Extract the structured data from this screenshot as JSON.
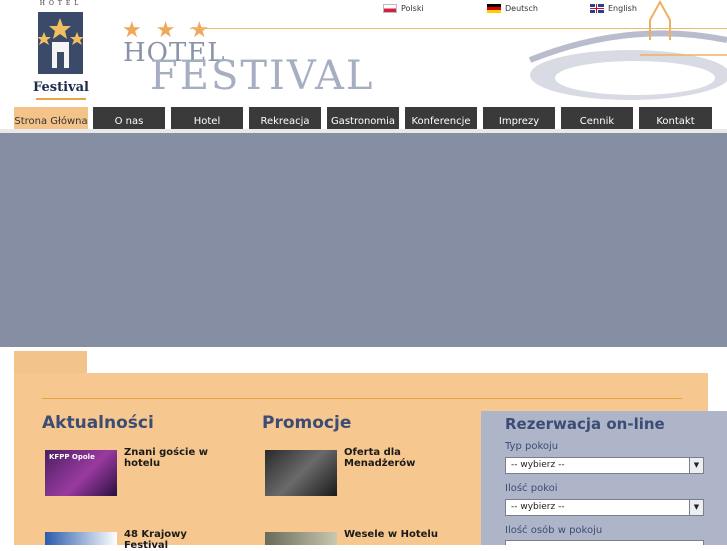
{
  "header": {
    "logo_small": "HOTEL",
    "logo_name": "Festival",
    "stars": "★★★",
    "title_hotel": "HOTEL",
    "title_festival": "FESTIVAL"
  },
  "languages": [
    {
      "label": "Polski",
      "flag": "poland-flag-icon"
    },
    {
      "label": "Deutsch",
      "flag": "germany-flag-icon"
    },
    {
      "label": "English",
      "flag": "uk-flag-icon"
    }
  ],
  "nav": [
    {
      "label": "Strona Główna",
      "active": true
    },
    {
      "label": "O nas"
    },
    {
      "label": "Hotel"
    },
    {
      "label": "Rekreacja"
    },
    {
      "label": "Gastronomia"
    },
    {
      "label": "Konferencje"
    },
    {
      "label": "Imprezy"
    },
    {
      "label": "Cennik"
    },
    {
      "label": "Kontakt"
    }
  ],
  "news": {
    "title": "Aktualności",
    "items": [
      {
        "text": "Znani goście w hotelu",
        "thumb_label": "KFPP Opole"
      },
      {
        "text": "48 Krajowy Festival",
        "thumb_label": ""
      }
    ]
  },
  "promotions": {
    "title": "Promocje",
    "items": [
      {
        "text": "Oferta dla Menadżerów"
      },
      {
        "text": "Wesele w Hotelu"
      }
    ]
  },
  "booking": {
    "title": "Rezerwacja on-line",
    "fields": [
      {
        "label": "Typ pokoju",
        "value": "-- wybierz --"
      },
      {
        "label": "Ilość pokoi",
        "value": "-- wybierz --"
      },
      {
        "label": "Ilość osób w pokoju",
        "value": ""
      }
    ]
  },
  "colors": {
    "accent": "#f4c38a",
    "nav_bg": "#3a3a3a",
    "banner": "#868ea4",
    "title_blue": "#3c4c74"
  }
}
